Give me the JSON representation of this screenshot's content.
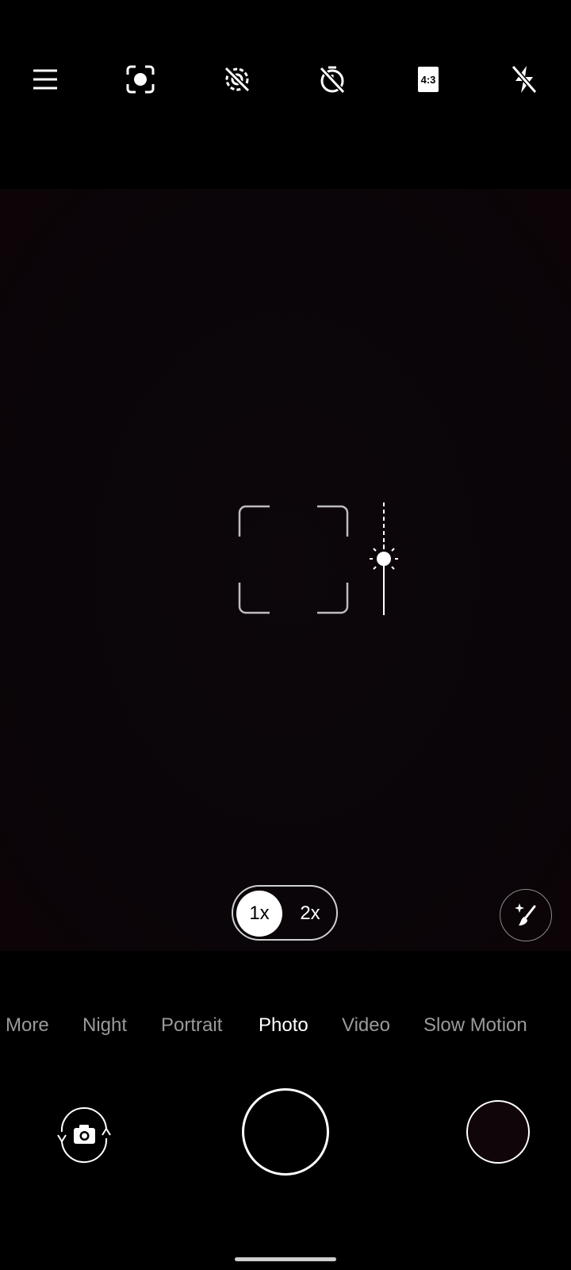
{
  "top_bar": {
    "icons": [
      "menu-icon",
      "scan-focus-icon",
      "motion-off-icon",
      "timer-off-icon",
      "aspect-ratio-icon",
      "flash-off-icon"
    ],
    "aspect_ratio_label": "4:3"
  },
  "zoom": {
    "options": [
      "1x",
      "2x"
    ],
    "selected": "1x"
  },
  "modes": {
    "items": [
      "More",
      "Night",
      "Portrait",
      "Photo",
      "Video",
      "Slow Motion"
    ],
    "active": "Photo"
  },
  "colors": {
    "accent": "#ffffff",
    "inactive_text": "#9a9a9a",
    "background": "#000000"
  }
}
